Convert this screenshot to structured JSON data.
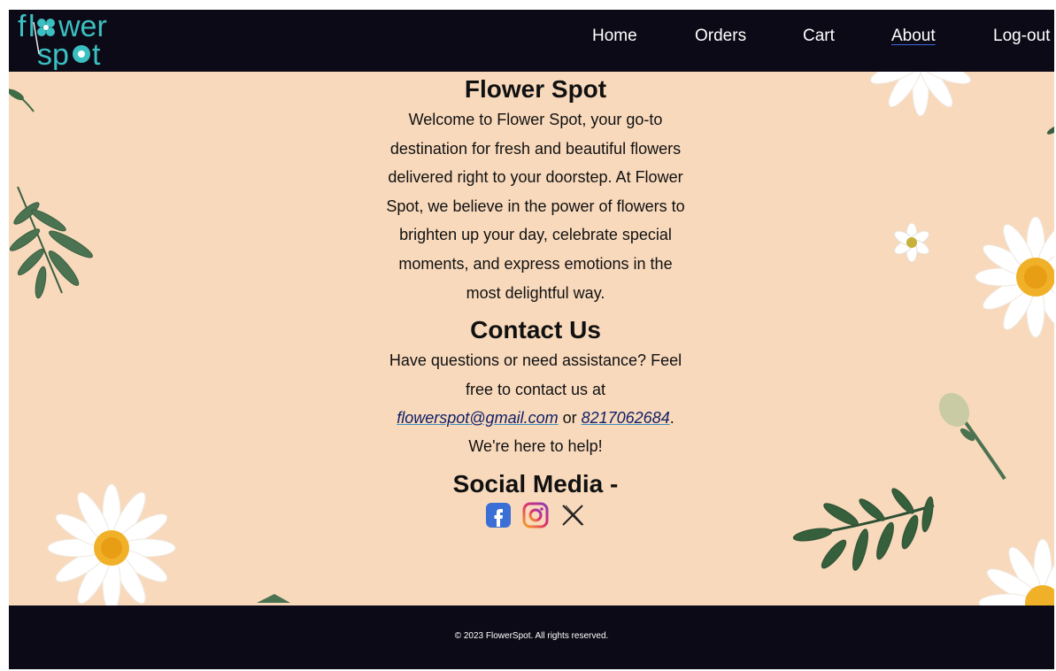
{
  "brand": {
    "logo_line1": "flower",
    "logo_line2": "spot",
    "color_teal": "#3bbfc0"
  },
  "nav": {
    "items": [
      {
        "label": "Home"
      },
      {
        "label": "Orders"
      },
      {
        "label": "Cart"
      },
      {
        "label": "About",
        "active": true
      },
      {
        "label": "Log-out"
      }
    ]
  },
  "about": {
    "title": "Flower Spot",
    "lines": [
      "Welcome to Flower Spot, your go-to",
      "destination for fresh and beautiful flowers",
      "delivered right to your doorstep. At Flower",
      "Spot, we believe in the power of flowers to",
      "brighten up your day, celebrate special",
      "moments, and express emotions in the",
      "most delightful way."
    ]
  },
  "contact": {
    "title": "Contact Us",
    "line1": "Have questions or need assistance? Feel",
    "line2": "free to contact us at",
    "email": "flowerspot@gmail.com",
    "or_text": " or ",
    "phone": "8217062684",
    "period": ".",
    "line4": "We're here to help!"
  },
  "social": {
    "title": "Social Media -",
    "icons": [
      "facebook-icon",
      "instagram-icon",
      "x-icon"
    ]
  },
  "footer": {
    "text": "© 2023 FlowerSpot. All rights reserved."
  },
  "colors": {
    "nav_bg": "#0d0a17",
    "hero_bg": "#f8d9bc",
    "facebook": "#3b6fd6",
    "instagram_start": "#f5a623",
    "instagram_end": "#b0309a"
  }
}
